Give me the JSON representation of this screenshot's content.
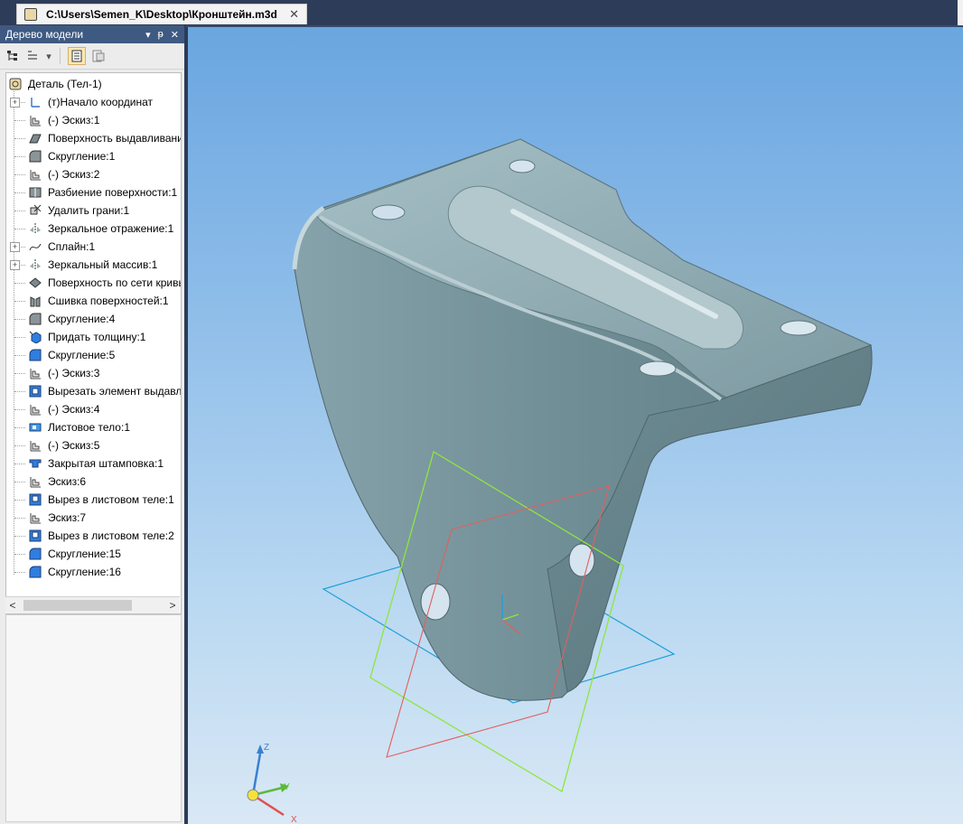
{
  "document_tab": {
    "title": "C:\\Users\\Semen_K\\Desktop\\Кронштейн.m3d",
    "close": "✕"
  },
  "panel": {
    "title": "Дерево модели",
    "header_buttons": [
      "▾",
      "ᵽ",
      "✕"
    ],
    "toolbar_icons": [
      "tree-structure-icon",
      "tree-view-icon",
      "dropdown-arrow-icon",
      "document-view-icon",
      "properties-icon"
    ]
  },
  "tree": {
    "root": {
      "label": "Деталь (Тел-1)",
      "icon": "part-icon"
    },
    "items": [
      {
        "label": "(т)Начало координат",
        "icon": "origin-icon",
        "expandable": true
      },
      {
        "label": "(-) Эскиз:1",
        "icon": "sketch-icon",
        "expandable": false
      },
      {
        "label": "Поверхность выдавливания",
        "icon": "extrude-surface-icon",
        "expandable": false
      },
      {
        "label": "Скругление:1",
        "icon": "fillet-icon",
        "expandable": false
      },
      {
        "label": "(-) Эскиз:2",
        "icon": "sketch-icon",
        "expandable": false
      },
      {
        "label": "Разбиение поверхности:1",
        "icon": "split-surface-icon",
        "expandable": false
      },
      {
        "label": "Удалить грани:1",
        "icon": "delete-faces-icon",
        "expandable": false
      },
      {
        "label": "Зеркальное отражение:1",
        "icon": "mirror-icon",
        "expandable": false
      },
      {
        "label": "Сплайн:1",
        "icon": "spline-icon",
        "expandable": true
      },
      {
        "label": "Зеркальный массив:1",
        "icon": "mirror-array-icon",
        "expandable": true
      },
      {
        "label": "Поверхность по сети кривых",
        "icon": "network-surface-icon",
        "expandable": false
      },
      {
        "label": "Сшивка поверхностей:1",
        "icon": "stitch-icon",
        "expandable": false
      },
      {
        "label": "Скругление:4",
        "icon": "fillet-icon",
        "expandable": false
      },
      {
        "label": "Придать толщину:1",
        "icon": "thicken-icon",
        "expandable": false
      },
      {
        "label": "Скругление:5",
        "icon": "fillet-blue-icon",
        "expandable": false
      },
      {
        "label": "(-) Эскиз:3",
        "icon": "sketch-icon",
        "expandable": false
      },
      {
        "label": "Вырезать элемент выдавливания",
        "icon": "cut-extrude-icon",
        "expandable": false
      },
      {
        "label": "(-) Эскиз:4",
        "icon": "sketch-icon",
        "expandable": false
      },
      {
        "label": "Листовое тело:1",
        "icon": "sheet-body-icon",
        "expandable": false
      },
      {
        "label": "(-) Эскиз:5",
        "icon": "sketch-icon",
        "expandable": false
      },
      {
        "label": "Закрытая штамповка:1",
        "icon": "stamp-icon",
        "expandable": false
      },
      {
        "label": "Эскиз:6",
        "icon": "sketch-icon",
        "expandable": false
      },
      {
        "label": "Вырез в листовом теле:1",
        "icon": "sheet-cut-icon",
        "expandable": false
      },
      {
        "label": "Эскиз:7",
        "icon": "sketch-icon",
        "expandable": false
      },
      {
        "label": "Вырез в листовом теле:2",
        "icon": "sheet-cut-icon",
        "expandable": false
      },
      {
        "label": "Скругление:15",
        "icon": "fillet-blue-icon",
        "expandable": false
      },
      {
        "label": "Скругление:16",
        "icon": "fillet-blue-icon",
        "expandable": false
      }
    ]
  },
  "scrollbar": {
    "left": "<",
    "right": ">"
  },
  "triad": {
    "z": "Z",
    "y": "Y",
    "x": "X"
  },
  "colors": {
    "part": "#7f9ea6",
    "plane_blue": "#1ea0d8",
    "plane_green": "#8ee63c",
    "plane_red": "#e06060",
    "viewport_top": "#6aa6e0"
  }
}
